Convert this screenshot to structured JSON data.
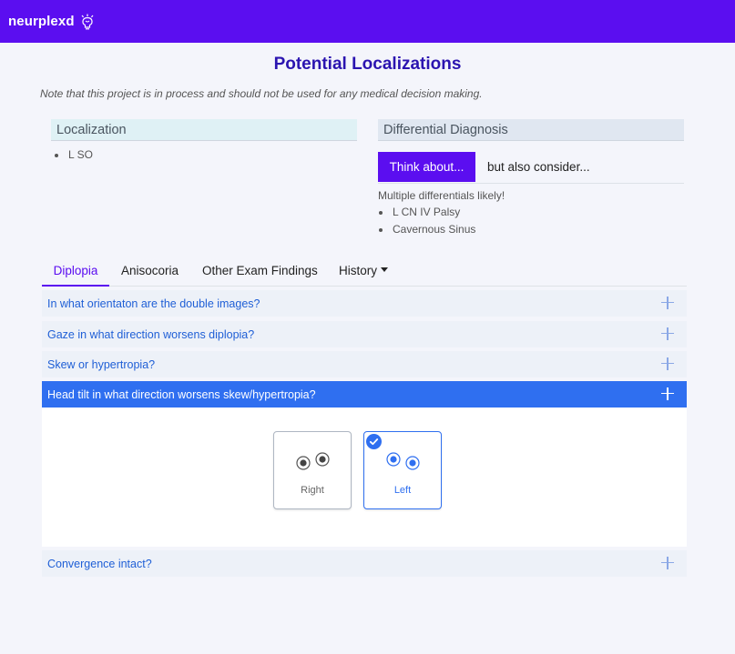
{
  "navbar": {
    "brand": "neurplexd"
  },
  "page": {
    "title": "Potential Localizations",
    "note": "Note that this project is in process and should not be used for any medical decision making."
  },
  "localization": {
    "header": "Localization",
    "items": [
      "L SO"
    ]
  },
  "differential": {
    "header": "Differential Diagnosis",
    "think_button": "Think about...",
    "also_consider": "but also consider...",
    "note": "Multiple differentials likely!",
    "items": [
      "L CN IV Palsy",
      "Cavernous Sinus"
    ]
  },
  "tabs": [
    {
      "label": "Diplopia",
      "active": true
    },
    {
      "label": "Anisocoria"
    },
    {
      "label": "Other Exam Findings"
    },
    {
      "label": "History"
    }
  ],
  "accordion": [
    {
      "question": "In what orientaton are the double images?"
    },
    {
      "question": "Gaze in what direction worsens diplopia?"
    },
    {
      "question": "Skew or hypertropia?"
    },
    {
      "question": "Head tilt in what direction worsens skew/hypertropia?",
      "expanded": true
    },
    {
      "question": "Convergence intact?"
    }
  ],
  "head_tilt_options": [
    {
      "label": "Right",
      "selected": false,
      "icon": "eyes-right-tilt-icon"
    },
    {
      "label": "Left",
      "selected": true,
      "icon": "eyes-left-tilt-icon"
    }
  ],
  "colors": {
    "brand": "#5b0ef0",
    "title": "#2b14b0",
    "accent": "#2f6ff0",
    "link": "#1f5fd6"
  }
}
